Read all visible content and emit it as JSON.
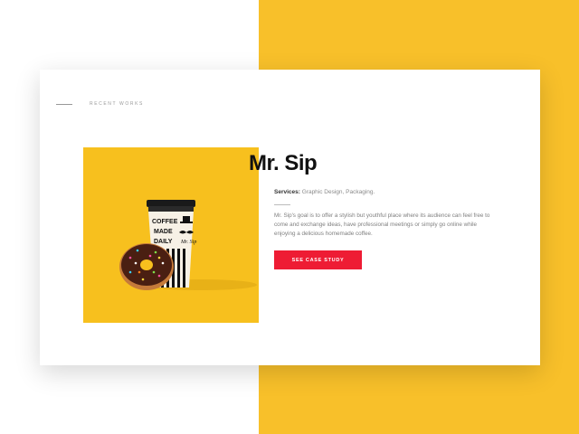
{
  "section": {
    "eyebrow": "RECENT WORKS"
  },
  "project": {
    "title": "Mr. Sip",
    "services_label": "Services:",
    "services_value": "Graphic Design, Packaging.",
    "description": "Mr. Sip's goal is to offer a stylish but youthful place where its audience can feel free to come and exchange ideas, have professional meetings or simply go online while enjoying a delicious homemade coffee.",
    "cta_label": "SEE CASE STUDY",
    "image": {
      "icon": "coffee-cup-donut-illustration",
      "cup_text": [
        "COFFEE",
        "MADE",
        "DAILY"
      ],
      "brand_mark": "Mr. Sip"
    }
  },
  "colors": {
    "accent_yellow": "#f8c02a",
    "cta_red": "#ee1c34",
    "card": "#ffffff"
  }
}
